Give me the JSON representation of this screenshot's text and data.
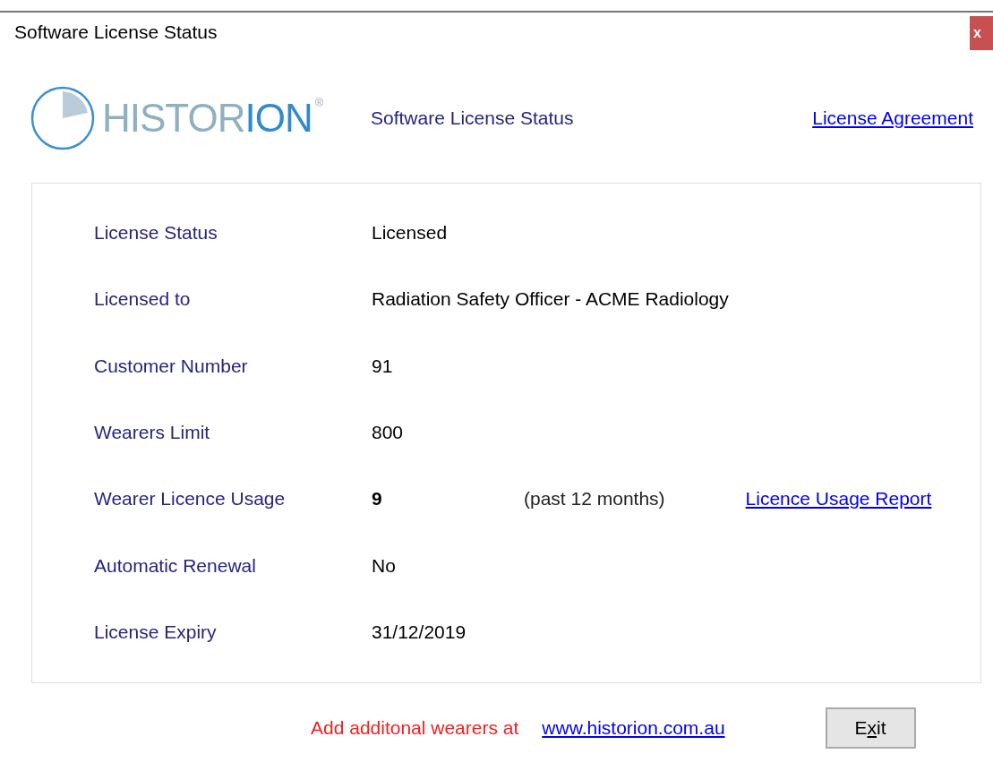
{
  "window": {
    "title": "Software License Status",
    "close": "x"
  },
  "header": {
    "logo": {
      "part_1": "HISTOR",
      "part_2": "ION",
      "mark": "®"
    },
    "title": "Software License Status",
    "link": "License Agreement"
  },
  "details": [
    {
      "kind": "plain",
      "label": "License Status",
      "value": "Licensed"
    },
    {
      "kind": "plain",
      "label": "Licensed to",
      "value": "Radiation Safety Officer - ACME Radiology"
    },
    {
      "kind": "plain",
      "label": "Customer Number",
      "value": "91"
    },
    {
      "kind": "plain",
      "label": "Wearers Limit",
      "value": "800"
    },
    {
      "kind": "usage",
      "label": "Wearer Licence Usage",
      "value": "9",
      "note": "(past 12 months)",
      "link": "Licence Usage Report"
    },
    {
      "kind": "plain",
      "label": "Automatic Renewal",
      "value": "No"
    },
    {
      "kind": "plain",
      "label": "License Expiry",
      "value": "31/12/2019"
    }
  ],
  "footer": {
    "message": "Add additonal wearers at",
    "link": "www.historion.com.au",
    "button": {
      "label_start": "E",
      "access_key": "x",
      "label_end": "it"
    }
  }
}
